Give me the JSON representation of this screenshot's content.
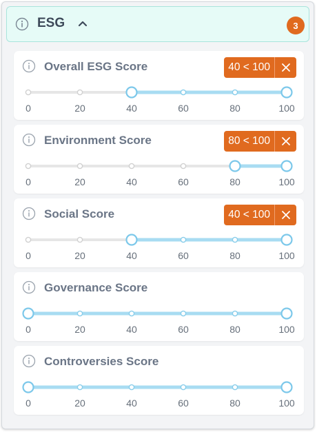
{
  "header": {
    "title": "ESG",
    "badge": "3",
    "info_icon": "info-icon",
    "chevron_icon": "chevron-up-icon"
  },
  "colors": {
    "accent": "#e06a1f",
    "track_active": "#a8dcf2",
    "track_inactive": "#e6e6e6",
    "header_bg": "#e6fbf7"
  },
  "ticks": [
    "0",
    "20",
    "40",
    "60",
    "80",
    "100"
  ],
  "sliders": [
    {
      "title": "Overall ESG Score",
      "filter": "40 < 100",
      "min": 40,
      "max": 100
    },
    {
      "title": "Environment Score",
      "filter": "80 < 100",
      "min": 80,
      "max": 100
    },
    {
      "title": "Social Score",
      "filter": "40 < 100",
      "min": 40,
      "max": 100
    },
    {
      "title": "Governance Score",
      "filter": "",
      "min": 0,
      "max": 100
    },
    {
      "title": "Controversies Score",
      "filter": "",
      "min": 0,
      "max": 100
    }
  ]
}
